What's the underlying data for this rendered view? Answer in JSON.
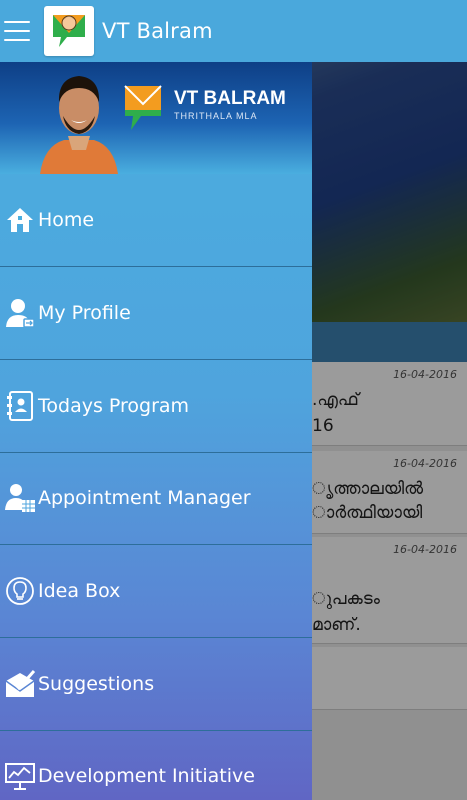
{
  "appbar": {
    "title": "VT Balram"
  },
  "drawer": {
    "brand_name": "VT BALRAM",
    "brand_sub": "THRITHALA MLA",
    "items": [
      {
        "label": "Home",
        "icon": "home-icon"
      },
      {
        "label": "My Profile",
        "icon": "profile-icon"
      },
      {
        "label": "Todays Program",
        "icon": "program-icon"
      },
      {
        "label": "Appointment Manager",
        "icon": "appointment-icon"
      },
      {
        "label": "Idea Box",
        "icon": "bulb-icon"
      },
      {
        "label": "Suggestions",
        "icon": "suggestions-icon"
      },
      {
        "label": "Development Initiative",
        "icon": "presentation-icon"
      }
    ]
  },
  "feed": {
    "cards": [
      {
        "date": "16-04-2016",
        "line1": ".എഫ്",
        "line2": "16"
      },
      {
        "date": "16-04-2016",
        "line1": "ൃത്താലയിൽ",
        "line2": "ാർത്ഥിയായി"
      },
      {
        "date": "16-04-2016",
        "line1": "ുപകടം",
        "line2": "മാണ്."
      }
    ]
  },
  "colors": {
    "appbar": "#4aa8dc",
    "drawer_top": "#4aaedf",
    "drawer_bottom": "#6066c4",
    "divider": "#2d6e9a"
  }
}
